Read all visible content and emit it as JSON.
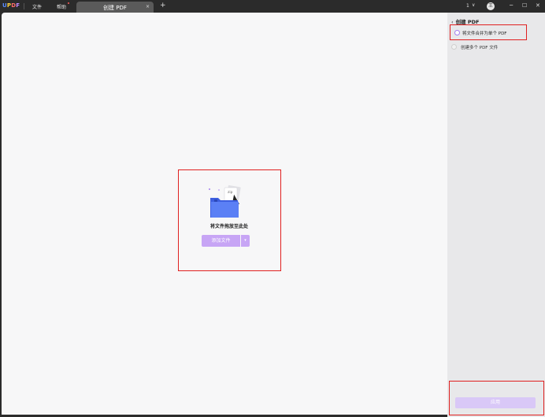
{
  "app": {
    "logo": [
      "U",
      "P",
      "D",
      "F"
    ],
    "menu": {
      "file": "文件",
      "help": "帮助"
    }
  },
  "tab": {
    "title": "创建 PDF",
    "close": "×",
    "new": "+"
  },
  "window": {
    "page_number": "1",
    "page_chevron": "∨",
    "avatar_initial": "王",
    "minimize": "─",
    "maximize": "☐",
    "close": "✕"
  },
  "dropzone": {
    "text": "将文件拖放至此处",
    "add_button_label": "添加文件",
    "dropdown_glyph": "▾",
    "illustration_tag": "zip"
  },
  "panel": {
    "back": "‹",
    "title": "创建 PDF",
    "options": [
      {
        "label": "将文件合并为单个 PDF",
        "selected": true
      },
      {
        "label": "创建多个 PDF 文件",
        "selected": false
      }
    ],
    "apply_label": "应用"
  },
  "colors": {
    "accent": "#a37ef0",
    "button_bg": "#c7a5f5",
    "highlight": "#e02020",
    "folder": "#4f74f2"
  }
}
